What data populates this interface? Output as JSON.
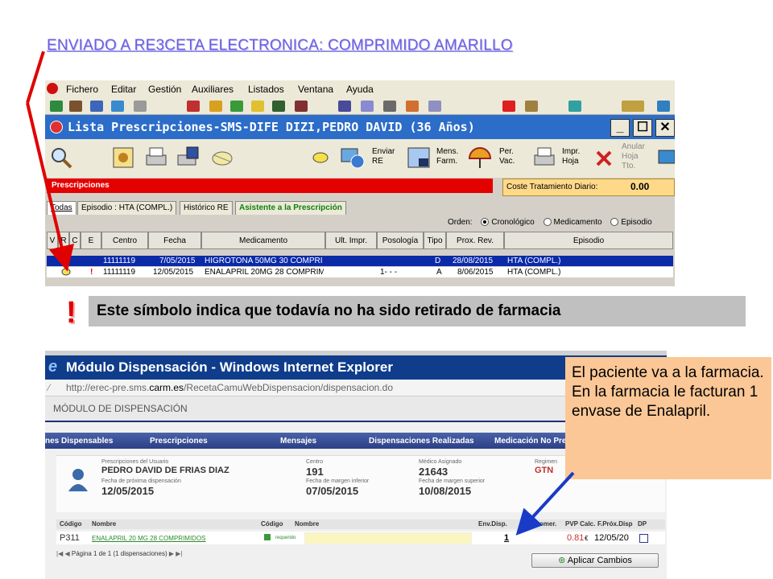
{
  "slide": {
    "title": "ENVIADO A  RE3CETA  ELECTRONICA: COMPRIMIDO  AMARILLO",
    "banner_text": "Este  símbolo indica  que  todavía no  ha sido  retirado  de  farmacia",
    "callout_text": "El paciente  va  a  la farmacia. En la farmacia  le  facturan 1  envase de Enalapril."
  },
  "app": {
    "menu": [
      "Fichero",
      "Editar",
      "Gestión",
      "Auxiliares",
      "Listados",
      "Ventana",
      "Ayuda"
    ],
    "window_title": "Lista Prescripciones-SMS-DIFE DIZI,PEDRO DAVID (36 Años)",
    "toolbar": {
      "enviar": "Enviar",
      "enviar2": "RE",
      "mens": "Mens.",
      "mens2": "Farm.",
      "per": "Per.",
      "per2": "Vac.",
      "impr": "Impr.",
      "impr2": "Hoja",
      "anular": "Anular",
      "anular2": "Hoja",
      "anular3": "Tto."
    },
    "section_label": "Prescripciones",
    "coste_label": "Coste Tratamiento Diario:",
    "coste_value": "0.00",
    "tabs": [
      "Todas",
      "Episodio : HTA (COMPL.)",
      "Histórico RE",
      "Asistente a la Prescripción"
    ],
    "orden_label": "Orden:",
    "orden_options": [
      "Cronológico",
      "Medicamento",
      "Episodio"
    ],
    "columns": [
      "V",
      "R",
      "C",
      "E",
      "Centro",
      "Fecha",
      "Medicamento",
      "Ult. Impr.",
      "Posología",
      "Tipo",
      "Prox. Rev.",
      "Episodio"
    ],
    "rows": [
      {
        "centro": "11111119",
        "fecha": "7/05/2015",
        "medicamento": "HIGROTONA 50MG 30 COMPRI",
        "posologia": "",
        "tipo": "D",
        "prox_rev": "28/08/2015",
        "episodio": "HTA (COMPL.)",
        "flag": ""
      },
      {
        "centro": "11111119",
        "fecha": "12/05/2015",
        "medicamento": "ENALAPRIL 20MG 28 COMPRIM",
        "posologia": "1- - -",
        "tipo": "A",
        "prox_rev": "8/06/2015",
        "episodio": "HTA (COMPL.)",
        "flag": "!"
      }
    ]
  },
  "ie": {
    "window_title": "Módulo Dispensación - Windows Internet Explorer",
    "url_prefix": "http://erec-pre.sms.",
    "url_domain": "carm.es",
    "url_suffix": "/RecetaCamuWebDispensacion/dispensacion.do",
    "module_header": "MÓDULO DE DISPENSACIÓN",
    "nav": [
      "nes Dispensables",
      "Prescripciones",
      "Mensajes",
      "Dispensaciones Realizadas",
      "Medicación No Pre"
    ],
    "patient": {
      "label_prescripciones": "Prescripciones del Usuario",
      "name": "PEDRO DAVID DE FRIAS DIAZ",
      "label_next": "Fecha de próxima dispensación",
      "next_date": "12/05/2015",
      "label_centro": "Centro",
      "centro": "191",
      "label_margen_inf": "Fecha de margen inferior",
      "margen_inf": "07/05/2015",
      "label_medico": "Médico Asignado",
      "medico": "21643",
      "label_margen_sup": "Fecha de margen superior",
      "margen_sup": "10/08/2015",
      "label_regimen": "Regimen",
      "regimen": "GTN"
    },
    "table_headers": [
      "Código",
      "Nombre",
      "Código",
      "Nombre",
      "Env.Disp.",
      "PVP Comer.",
      "PVP Calc.",
      "F.Próx.Disp",
      "DP"
    ],
    "row": {
      "codigo": "P311",
      "nombre": "ENALAPRIL 20 MG 28 COMPRIMIDOS",
      "estado": "requerido",
      "env_disp": "1",
      "pvp_calc": "0.81",
      "currency": "€",
      "f_prox": "12/05/20"
    },
    "pager": "Página  1  de  1  (1 dispensaciones)",
    "apply_label": "Aplicar Cambios"
  }
}
